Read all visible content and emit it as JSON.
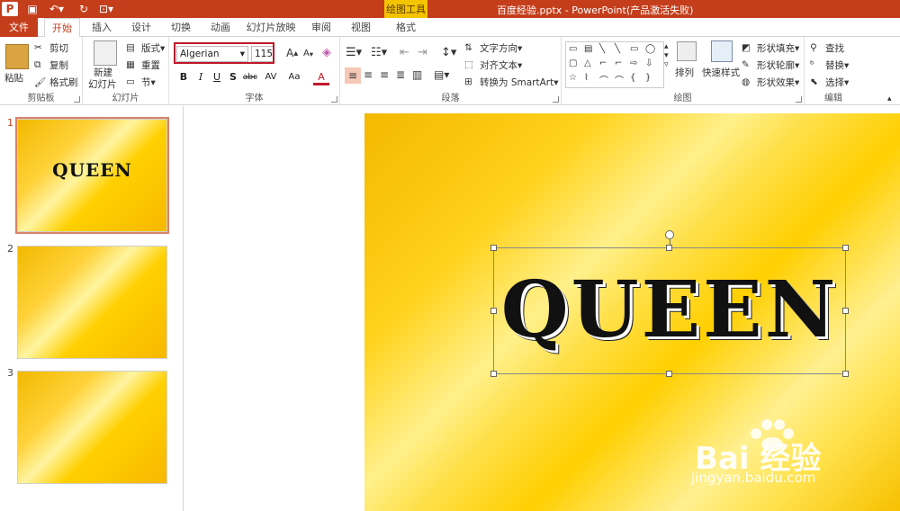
{
  "app": {
    "window_title": "百度经验.pptx - PowerPoint(产品激活失败)",
    "context_tab_group": "绘图工具",
    "accent": "#c43e1c"
  },
  "quick_access": [
    {
      "name": "powerpoint-logo-icon",
      "glyph": "P"
    },
    {
      "name": "save-icon",
      "glyph": "💾"
    },
    {
      "name": "undo-icon",
      "glyph": "↶"
    },
    {
      "name": "redo-icon",
      "glyph": "↻"
    },
    {
      "name": "present-icon",
      "glyph": "⊡"
    }
  ],
  "tabs": {
    "file": "文件",
    "home": "开始",
    "insert": "插入",
    "design": "设计",
    "transitions": "切换",
    "animations": "动画",
    "slideshow": "幻灯片放映",
    "review": "审阅",
    "view": "视图",
    "format": "格式"
  },
  "ribbon": {
    "clipboard": {
      "label": "剪贴板",
      "paste": "粘贴",
      "cut": "剪切",
      "copy": "复制",
      "format_painter": "格式刷"
    },
    "slides": {
      "label": "幻灯片",
      "new_slide": "新建",
      "new_slide_2": "幻灯片",
      "layout": "版式",
      "reset": "重置",
      "section": "节"
    },
    "font": {
      "label": "字体",
      "font_name": "Algerian",
      "font_size": "115",
      "bold": "B",
      "italic": "I",
      "underline": "U",
      "shadow": "S",
      "strike": "abc",
      "spacing": "AV",
      "case": "Aa",
      "color": "A",
      "grow": "A",
      "shrink": "A"
    },
    "paragraph": {
      "label": "段落",
      "text_direction": "文字方向",
      "align_text": "对齐文本",
      "convert_smartart": "转换为 SmartArt"
    },
    "drawing": {
      "label": "绘图",
      "arrange": "排列",
      "quick_styles": "快速样式",
      "shape_fill": "形状填充",
      "shape_outline": "形状轮廓",
      "shape_effects": "形状效果",
      "gallery": [
        "▭",
        "▤",
        "\\",
        "\\",
        "▭",
        "◯",
        "▭",
        "△",
        "⌐",
        "⌐",
        "⇨",
        "⇩",
        "△",
        "⌇",
        "⌒",
        "⌒",
        "{",
        "}",
        "☆"
      ]
    },
    "editing": {
      "label": "编辑",
      "find": "查找",
      "replace": "替换",
      "select": "选择"
    }
  },
  "thumbnails": [
    {
      "number": "1",
      "text": "QUEEN",
      "selected": true
    },
    {
      "number": "2",
      "text": ""
    },
    {
      "number": "3",
      "text": ""
    }
  ],
  "slide": {
    "text": "QUEEN"
  },
  "watermark": {
    "logo": "Bai 经验",
    "url": "jingyan.baidu.com"
  }
}
